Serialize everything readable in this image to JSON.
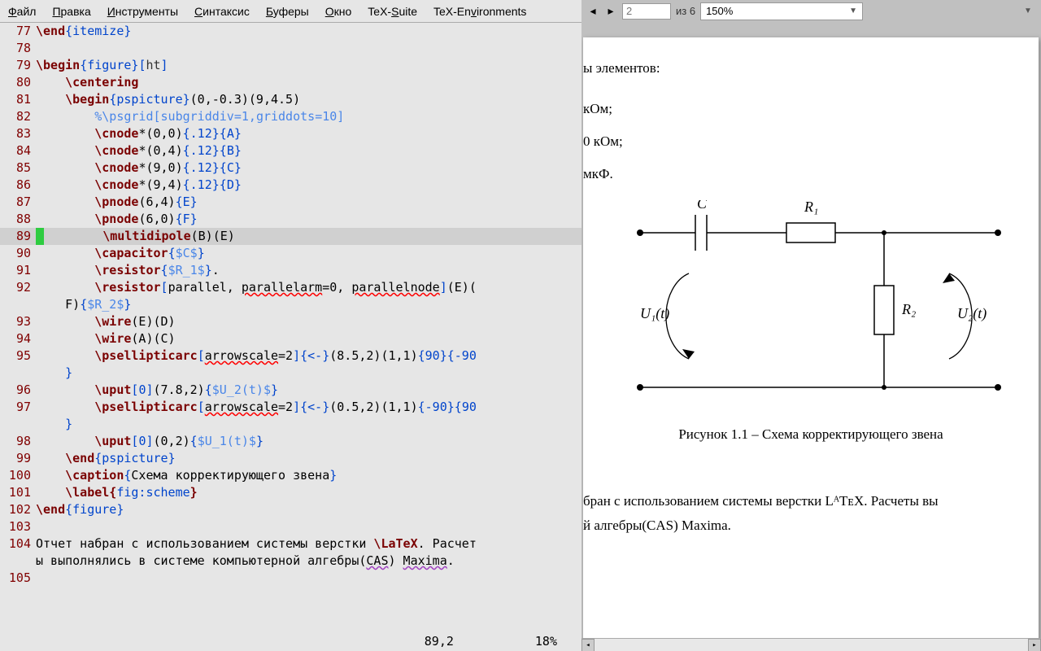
{
  "menu": {
    "items": [
      {
        "label": "Файл",
        "u": 0
      },
      {
        "label": "Правка",
        "u": 0
      },
      {
        "label": "Инструменты",
        "u": 0
      },
      {
        "label": "Синтаксис",
        "u": 0
      },
      {
        "label": "Буферы",
        "u": 0
      },
      {
        "label": "Окно",
        "u": 0
      },
      {
        "label": "TeX-Suite",
        "u": 4
      },
      {
        "label": "TeX-Environments",
        "u": 6
      }
    ]
  },
  "toolbar": {
    "page_value": "2",
    "page_total_label": "из 6",
    "zoom_value": "150%"
  },
  "status": {
    "pos": "89,2",
    "percent": "18%"
  },
  "editor_lines": [
    {
      "n": 77,
      "spans": [
        [
          "c-cmd",
          "\\end"
        ],
        [
          "c-brace",
          "{"
        ],
        [
          "c-kw",
          "itemize"
        ],
        [
          "c-brace",
          "}"
        ]
      ]
    },
    {
      "n": 78,
      "spans": []
    },
    {
      "n": 79,
      "spans": [
        [
          "c-cmd",
          "\\begin"
        ],
        [
          "c-brace",
          "{"
        ],
        [
          "c-kw",
          "figure"
        ],
        [
          "c-brace",
          "}"
        ],
        [
          "c-opt",
          "["
        ],
        [
          "c-str",
          "ht"
        ],
        [
          "c-opt",
          "]"
        ]
      ]
    },
    {
      "n": 80,
      "spans": [
        [
          "",
          "    "
        ],
        [
          "c-cmd",
          "\\centering"
        ]
      ]
    },
    {
      "n": 81,
      "spans": [
        [
          "",
          "    "
        ],
        [
          "c-cmd",
          "\\begin"
        ],
        [
          "c-brace",
          "{"
        ],
        [
          "c-kw",
          "pspicture"
        ],
        [
          "c-brace",
          "}"
        ],
        [
          "",
          "(0,-0.3)(9,4.5)"
        ]
      ]
    },
    {
      "n": 82,
      "spans": [
        [
          "",
          "        "
        ],
        [
          "c-comment",
          "%"
        ],
        [
          "c-comment",
          "\\psgrid"
        ],
        [
          "c-comment",
          "["
        ],
        [
          "c-comment",
          "subgriddiv"
        ],
        [
          "c-comment",
          "=1,"
        ],
        [
          "c-comment",
          "griddots"
        ],
        [
          "c-comment",
          "=10]"
        ]
      ]
    },
    {
      "n": 83,
      "spans": [
        [
          "",
          "        "
        ],
        [
          "c-cmd",
          "\\cnode"
        ],
        [
          "",
          "*(0,0)"
        ],
        [
          "c-brace",
          "{"
        ],
        [
          "c-kw",
          ".12"
        ],
        [
          "c-brace",
          "}{"
        ],
        [
          "c-kw",
          "A"
        ],
        [
          "c-brace",
          "}"
        ]
      ]
    },
    {
      "n": 84,
      "spans": [
        [
          "",
          "        "
        ],
        [
          "c-cmd",
          "\\cnode"
        ],
        [
          "",
          "*(0,4)"
        ],
        [
          "c-brace",
          "{"
        ],
        [
          "c-kw",
          ".12"
        ],
        [
          "c-brace",
          "}{"
        ],
        [
          "c-kw",
          "B"
        ],
        [
          "c-brace",
          "}"
        ]
      ]
    },
    {
      "n": 85,
      "spans": [
        [
          "",
          "        "
        ],
        [
          "c-cmd",
          "\\cnode"
        ],
        [
          "",
          "*(9,0)"
        ],
        [
          "c-brace",
          "{"
        ],
        [
          "c-kw",
          ".12"
        ],
        [
          "c-brace",
          "}{"
        ],
        [
          "c-kw",
          "C"
        ],
        [
          "c-brace",
          "}"
        ]
      ]
    },
    {
      "n": 86,
      "spans": [
        [
          "",
          "        "
        ],
        [
          "c-cmd",
          "\\cnode"
        ],
        [
          "",
          "*(9,4)"
        ],
        [
          "c-brace",
          "{"
        ],
        [
          "c-kw",
          ".12"
        ],
        [
          "c-brace",
          "}{"
        ],
        [
          "c-kw",
          "D"
        ],
        [
          "c-brace",
          "}"
        ]
      ]
    },
    {
      "n": 87,
      "spans": [
        [
          "",
          "        "
        ],
        [
          "c-cmd",
          "\\pnode"
        ],
        [
          "",
          "(6,4)"
        ],
        [
          "c-brace",
          "{"
        ],
        [
          "c-kw",
          "E"
        ],
        [
          "c-brace",
          "}"
        ]
      ]
    },
    {
      "n": 88,
      "spans": [
        [
          "",
          "        "
        ],
        [
          "c-cmd",
          "\\pnode"
        ],
        [
          "",
          "(6,0)"
        ],
        [
          "c-brace",
          "{"
        ],
        [
          "c-kw",
          "F"
        ],
        [
          "c-brace",
          "}"
        ]
      ]
    },
    {
      "n": 89,
      "current": true,
      "spans": [
        [
          "",
          "        "
        ],
        [
          "c-cmd",
          "\\multidipole"
        ],
        [
          "",
          "(B)(E)"
        ]
      ]
    },
    {
      "n": 90,
      "spans": [
        [
          "",
          "        "
        ],
        [
          "c-cmd",
          "\\capacitor"
        ],
        [
          "c-brace",
          "{"
        ],
        [
          "c-math",
          "$C$"
        ],
        [
          "c-brace",
          "}"
        ]
      ]
    },
    {
      "n": 91,
      "spans": [
        [
          "",
          "        "
        ],
        [
          "c-cmd",
          "\\resistor"
        ],
        [
          "c-brace",
          "{"
        ],
        [
          "c-math",
          "$R_1$"
        ],
        [
          "c-brace",
          "}"
        ],
        [
          "",
          "."
        ]
      ]
    },
    {
      "n": 92,
      "spans": [
        [
          "",
          "        "
        ],
        [
          "c-cmd",
          "\\resistor"
        ],
        [
          "c-opt",
          "["
        ],
        [
          "",
          "parallel, "
        ],
        [
          "underline-red",
          "parallelarm"
        ],
        [
          "",
          "=0, "
        ],
        [
          "underline-red",
          "parallelnode"
        ],
        [
          "c-opt",
          "]"
        ],
        [
          "",
          "(E)("
        ]
      ]
    },
    {
      "n": "",
      "spans": [
        [
          "",
          "    F)"
        ],
        [
          "c-brace",
          "{"
        ],
        [
          "c-math",
          "$R_2$"
        ],
        [
          "c-brace",
          "}"
        ]
      ]
    },
    {
      "n": 93,
      "spans": [
        [
          "",
          "        "
        ],
        [
          "c-cmd",
          "\\wire"
        ],
        [
          "",
          "(E)(D)"
        ]
      ]
    },
    {
      "n": 94,
      "spans": [
        [
          "",
          "        "
        ],
        [
          "c-cmd",
          "\\wire"
        ],
        [
          "",
          "(A)(C)"
        ]
      ]
    },
    {
      "n": 95,
      "spans": [
        [
          "",
          "        "
        ],
        [
          "c-cmd",
          "\\psellipticarc"
        ],
        [
          "c-opt",
          "["
        ],
        [
          "underline-red",
          "arrowscale"
        ],
        [
          "",
          "=2"
        ],
        [
          "c-opt",
          "]"
        ],
        [
          "c-brace",
          "{"
        ],
        [
          "c-kw",
          "<-"
        ],
        [
          "c-brace",
          "}"
        ],
        [
          "",
          "(8.5,2)(1,1)"
        ],
        [
          "c-brace",
          "{"
        ],
        [
          "c-kw",
          "90"
        ],
        [
          "c-brace",
          "}{"
        ],
        [
          "c-kw",
          "-90"
        ]
      ]
    },
    {
      "n": "",
      "spans": [
        [
          "",
          "    "
        ],
        [
          "c-brace",
          "}"
        ]
      ]
    },
    {
      "n": 96,
      "spans": [
        [
          "",
          "        "
        ],
        [
          "c-cmd",
          "\\uput"
        ],
        [
          "c-opt",
          "["
        ],
        [
          "c-kw",
          "0"
        ],
        [
          "c-opt",
          "]"
        ],
        [
          "",
          "(7.8,2)"
        ],
        [
          "c-brace",
          "{"
        ],
        [
          "c-math",
          "$U_2(t)$"
        ],
        [
          "c-brace",
          "}"
        ]
      ]
    },
    {
      "n": 97,
      "spans": [
        [
          "",
          "        "
        ],
        [
          "c-cmd",
          "\\psellipticarc"
        ],
        [
          "c-opt",
          "["
        ],
        [
          "underline-red",
          "arrowscale"
        ],
        [
          "",
          "=2"
        ],
        [
          "c-opt",
          "]"
        ],
        [
          "c-brace",
          "{"
        ],
        [
          "c-kw",
          "<-"
        ],
        [
          "c-brace",
          "}"
        ],
        [
          "",
          "(0.5,2)(1,1)"
        ],
        [
          "c-brace",
          "{"
        ],
        [
          "c-kw",
          "-90"
        ],
        [
          "c-brace",
          "}{"
        ],
        [
          "c-kw",
          "90"
        ]
      ]
    },
    {
      "n": "",
      "spans": [
        [
          "",
          "    "
        ],
        [
          "c-brace",
          "}"
        ]
      ]
    },
    {
      "n": 98,
      "spans": [
        [
          "",
          "        "
        ],
        [
          "c-cmd",
          "\\uput"
        ],
        [
          "c-opt",
          "["
        ],
        [
          "c-kw",
          "0"
        ],
        [
          "c-opt",
          "]"
        ],
        [
          "",
          "(0,2)"
        ],
        [
          "c-brace",
          "{"
        ],
        [
          "c-math",
          "$U_1(t)$"
        ],
        [
          "c-brace",
          "}"
        ]
      ]
    },
    {
      "n": 99,
      "spans": [
        [
          "",
          "    "
        ],
        [
          "c-cmd",
          "\\end"
        ],
        [
          "c-brace",
          "{"
        ],
        [
          "c-kw",
          "pspicture"
        ],
        [
          "c-brace",
          "}"
        ]
      ]
    },
    {
      "n": 100,
      "spans": [
        [
          "",
          "    "
        ],
        [
          "c-cmd",
          "\\caption"
        ],
        [
          "c-brace",
          "{"
        ],
        [
          "",
          "Схема корректирующего звена"
        ],
        [
          "c-brace",
          "}"
        ]
      ]
    },
    {
      "n": 101,
      "spans": [
        [
          "",
          "    "
        ],
        [
          "c-cmd",
          "\\label{"
        ],
        [
          "c-kw",
          "fig:scheme"
        ],
        [
          "c-cmd",
          "}"
        ]
      ]
    },
    {
      "n": 102,
      "spans": [
        [
          "c-cmd",
          "\\end"
        ],
        [
          "c-brace",
          "{"
        ],
        [
          "c-kw",
          "figure"
        ],
        [
          "c-brace",
          "}"
        ]
      ]
    },
    {
      "n": 103,
      "spans": []
    },
    {
      "n": 104,
      "spans": [
        [
          "",
          "Отчет набран с использованием системы верстки "
        ],
        [
          "c-cmd",
          "\\LaTeX"
        ],
        [
          "",
          ". Расчет"
        ]
      ]
    },
    {
      "n": "",
      "spans": [
        [
          "",
          "ы выполнялись в системе компьютерной алгебры("
        ],
        [
          "underline-purple",
          "CAS"
        ],
        [
          "",
          ") "
        ],
        [
          "underline-purple",
          "Maxima"
        ],
        [
          "",
          "."
        ]
      ]
    },
    {
      "n": 105,
      "spans": []
    }
  ],
  "preview": {
    "frag1": "ы элементов:",
    "frag2": " кОм;",
    "frag3": "0 кОм;",
    "frag4": "мкФ.",
    "caption": "Рисунок 1.1 – Схема корректирующего звена",
    "body1": "бран с использованием системы верстки LᴬTᴇX. Расчеты вы",
    "body2": "й алгебры(CAS) Maxima.",
    "labels": {
      "C": "C",
      "R1": "R₁",
      "R2": "R₂",
      "U1": "U₁(t)",
      "U2": "U₂(t)"
    }
  }
}
